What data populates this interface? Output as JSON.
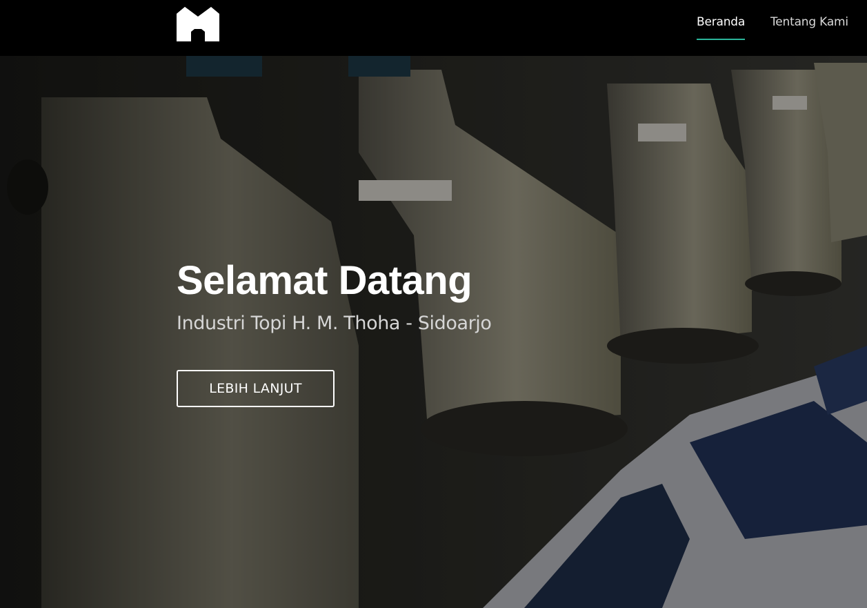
{
  "nav": {
    "logo_alt": "M logo",
    "links": [
      {
        "label": "Beranda",
        "active": true
      },
      {
        "label": "Tentang Kami",
        "active": false
      }
    ],
    "accent": "#2bb59a"
  },
  "hero": {
    "title": "Selamat Datang",
    "subtitle": "Industri Topi H. M. Thoha - Sidoarjo",
    "button_label": "LEBIH LANJUT",
    "background": "embroidery-machines-photo"
  }
}
